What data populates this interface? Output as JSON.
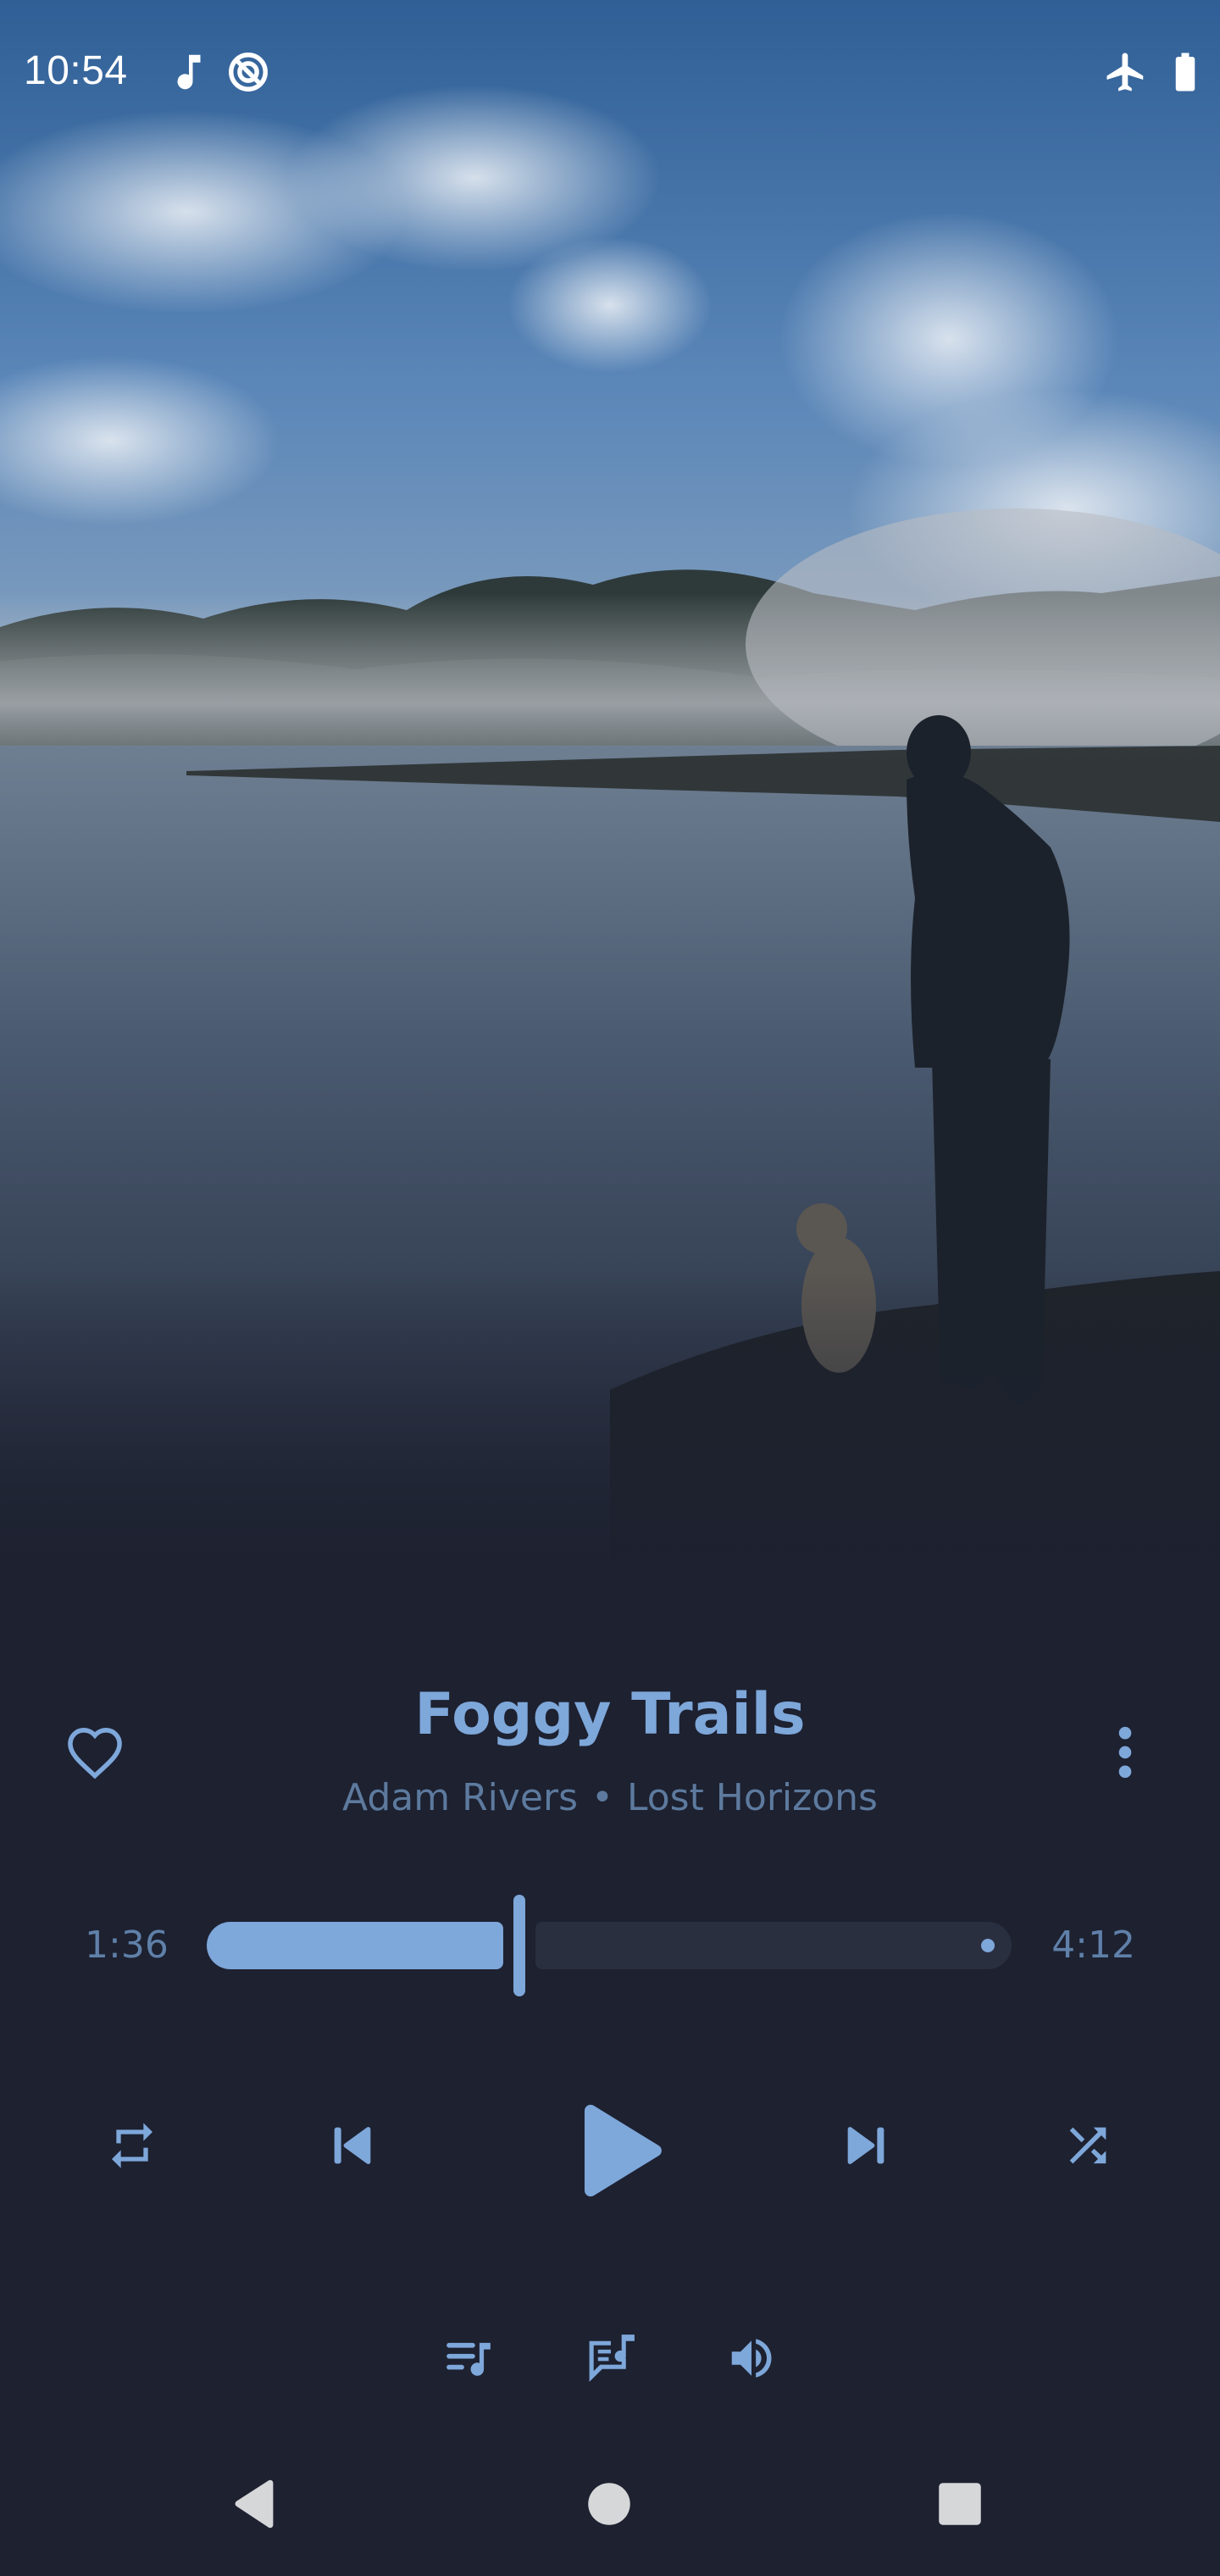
{
  "status_bar": {
    "time": "10:54",
    "icons": [
      "music-note-icon",
      "no-sync-icon",
      "airplane-mode-icon",
      "battery-icon"
    ]
  },
  "artwork": {
    "description_icon": "album-artwork"
  },
  "track": {
    "title": "Foggy Trails",
    "artist": "Adam Rivers",
    "separator": "•",
    "album": "Lost Horizons",
    "favorite_icon": "heart-outline-icon",
    "more_icon": "more-vertical-icon"
  },
  "progress": {
    "elapsed": "1:36",
    "total": "4:12",
    "fraction": 0.381
  },
  "controls": {
    "repeat_icon": "repeat-icon",
    "previous_icon": "skip-previous-icon",
    "play_icon": "play-icon",
    "next_icon": "skip-next-icon",
    "shuffle_icon": "shuffle-icon",
    "queue_icon": "queue-music-icon",
    "lyrics_icon": "lyrics-icon",
    "volume_icon": "volume-icon"
  },
  "navigation": {
    "icons": [
      "back-icon",
      "home-icon",
      "recents-icon"
    ]
  },
  "colors": {
    "background": "#1d2130",
    "accent": "#7ea7da",
    "muted_text": "#5d7a9e",
    "track_rest": "#2a2f40"
  }
}
